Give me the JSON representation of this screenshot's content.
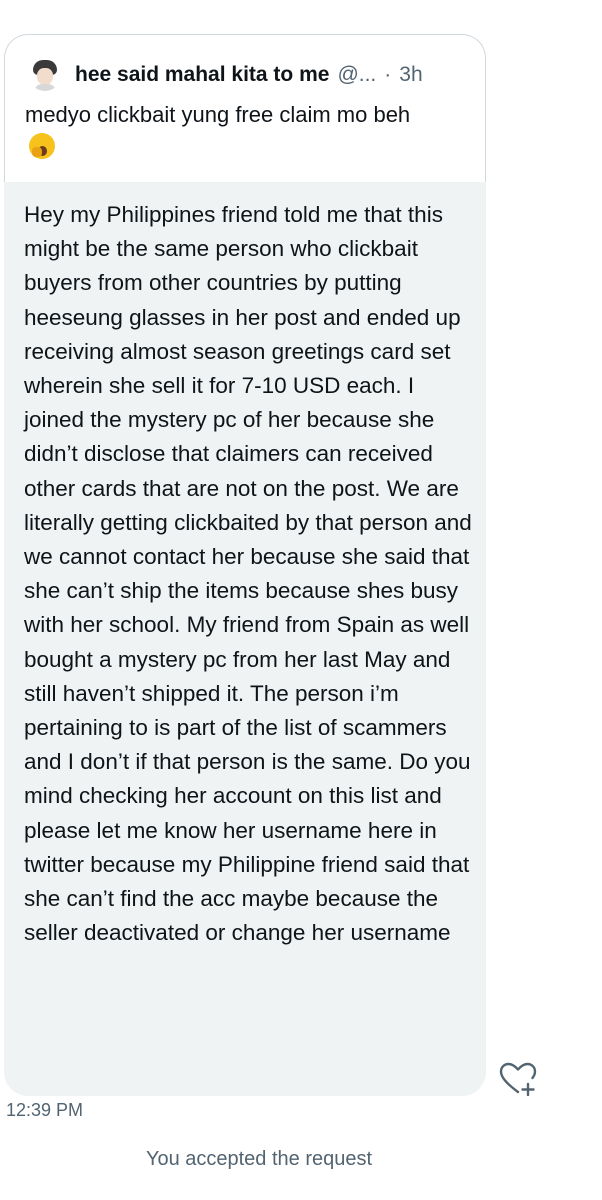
{
  "quoted_tweet": {
    "author_name": "hee said mahal kita to me",
    "author_handle": "@...",
    "separator": "·",
    "time": "3h",
    "text": "medyo clickbait yung free claim mo beh",
    "emoji": "yawning-face-emoji"
  },
  "message": {
    "text": "Hey my Philippines friend told me that this might be the same person who clickbait buyers from other countries by putting heeseung glasses in her post and ended up receiving almost season greetings card set wherein she sell it for 7-10 USD each. I joined the mystery pc of her because she didn’t disclose that claimers can received other cards that are not on the post. We are literally getting clickbaited by that person and we cannot contact her because she said that she can’t ship the items because shes busy with her school. My friend from Spain as well bought a mystery pc from her last May and still haven’t shipped it. The person i’m pertaining to is part of the list of scammers and I don’t if that person is the same. Do you mind checking her account on this list and please let me know her username here in twitter because my Philippine friend said that she can’t find the acc maybe because the seller deactivated or change her username",
    "timestamp": "12:39 PM"
  },
  "react_button": {
    "icon": "heart-plus-icon"
  },
  "status": {
    "text": "You accepted the request"
  },
  "colors": {
    "bubble_bg": "#eff3f4",
    "card_border": "#cfd9de",
    "secondary_text": "#536471",
    "primary_text": "#0f1419"
  }
}
